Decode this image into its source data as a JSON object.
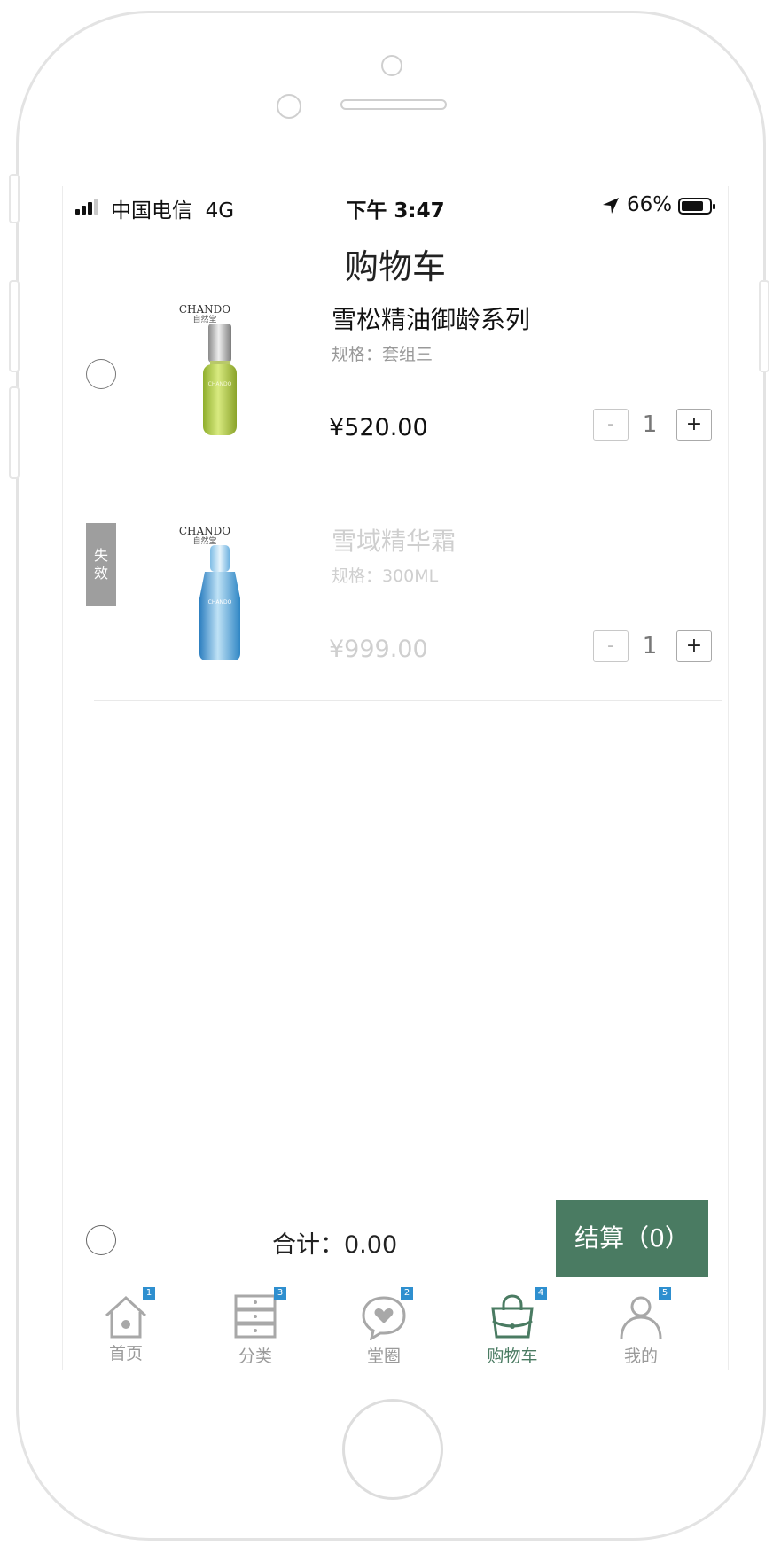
{
  "status_bar": {
    "carrier": "中国电信",
    "network": "4G",
    "time": "下午 3:47",
    "battery": "66%"
  },
  "page_title": "购物车",
  "items": [
    {
      "brand": "CHANDO",
      "brand_cn": "自然堂",
      "name": "雪松精油御龄系列",
      "spec": "规格：套组三",
      "price": "¥520.00",
      "qty_minus": "-",
      "qty": "1",
      "qty_plus": "+",
      "valid": true
    },
    {
      "brand": "CHANDO",
      "brand_cn": "自然堂",
      "invalid_badge": [
        "失",
        "效"
      ],
      "name": "雪域精华霜",
      "spec": "规格：300ML",
      "price": "¥999.00",
      "qty_minus": "-",
      "qty": "1",
      "qty_plus": "+",
      "valid": false
    }
  ],
  "footer": {
    "total": "合计：0.00",
    "checkout": "结算（0）"
  },
  "tabbar": [
    {
      "label": "首页",
      "icon": "home-icon",
      "badge": "1",
      "active": false
    },
    {
      "label": "分类",
      "icon": "drawer-icon",
      "badge": "3",
      "active": false
    },
    {
      "label": "堂圈",
      "icon": "heart-chat-icon",
      "badge": "2",
      "active": false
    },
    {
      "label": "购物车",
      "icon": "shopping-bag-icon",
      "badge": "4",
      "active": true
    },
    {
      "label": "我的",
      "icon": "user-icon",
      "badge": "5",
      "active": false
    }
  ],
  "colors": {
    "accent": "#4a7b62",
    "badge": "#2e8fcf",
    "muted": "#9a9a9a"
  }
}
